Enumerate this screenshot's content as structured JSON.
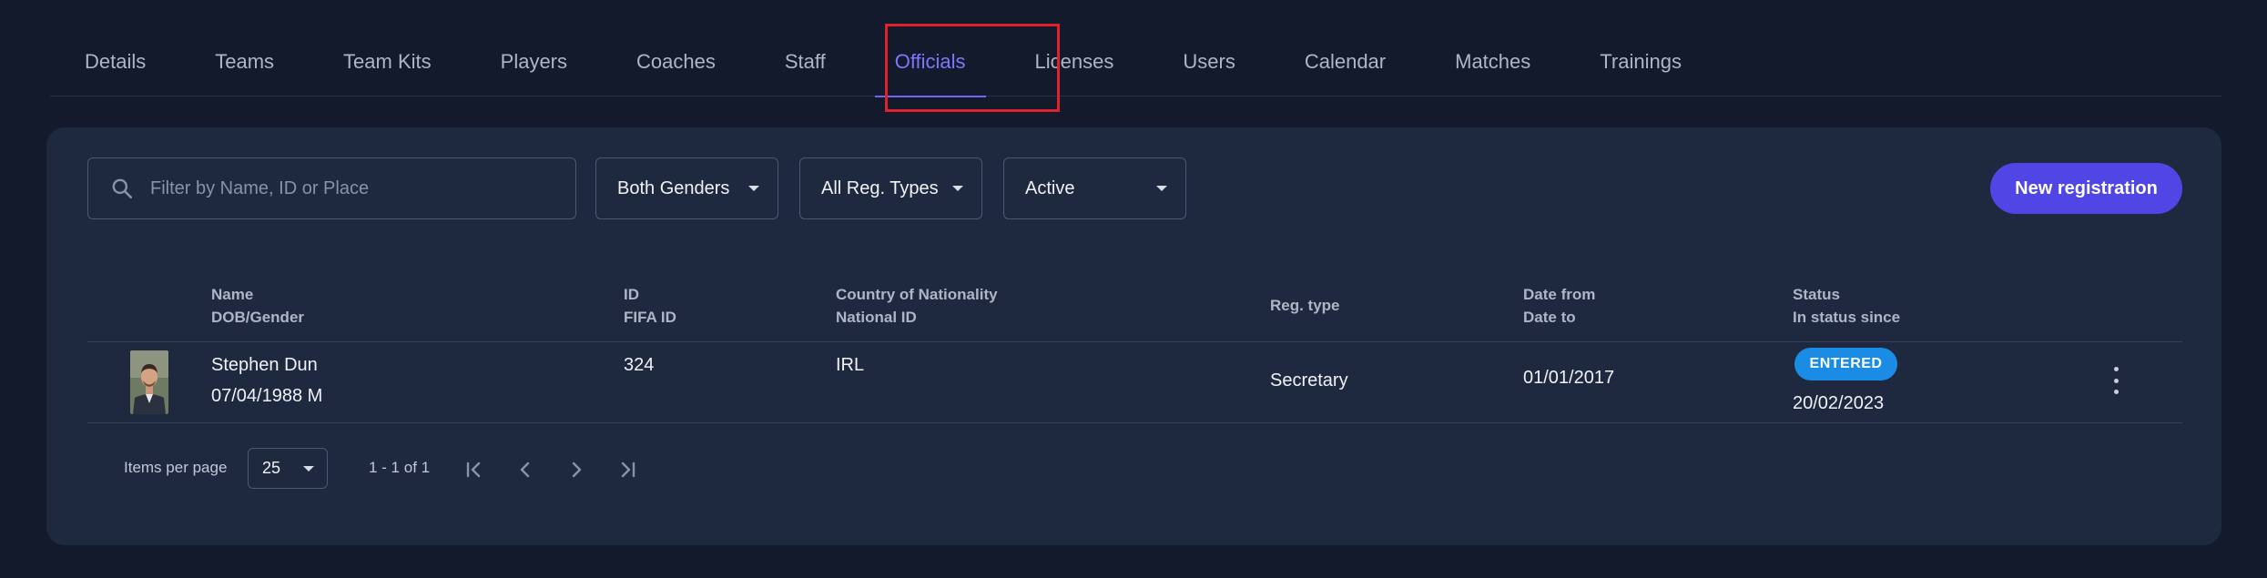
{
  "tabs": [
    "Details",
    "Teams",
    "Team Kits",
    "Players",
    "Coaches",
    "Staff",
    "Officials",
    "Licenses",
    "Users",
    "Calendar",
    "Matches",
    "Trainings"
  ],
  "active_tab": "Officials",
  "filters": {
    "search_placeholder": "Filter by Name, ID or Place",
    "gender": "Both Genders",
    "reg_type": "All Reg. Types",
    "status": "Active"
  },
  "new_registration_label": "New registration",
  "columns": {
    "name": "Name",
    "dob_gender": "DOB/Gender",
    "id": "ID",
    "fifa_id": "FIFA ID",
    "country": "Country of Nationality",
    "national_id": "National ID",
    "reg_type": "Reg. type",
    "date_from": "Date from",
    "date_to": "Date to",
    "status": "Status",
    "in_status_since": "In status since"
  },
  "rows": [
    {
      "name": "Stephen Dun",
      "dob_gender": "07/04/1988 M",
      "id": "324",
      "country": "IRL",
      "reg_type": "Secretary",
      "date_from": "01/01/2017",
      "status": "ENTERED",
      "status_since": "20/02/2023"
    }
  ],
  "pagination": {
    "items_per_page_label": "Items per page",
    "items_per_page": "25",
    "range": "1 - 1 of 1"
  },
  "colors": {
    "accent": "#5046e5",
    "status_entered": "#1a8ce6",
    "active_tab": "#7d76ff",
    "highlight": "#e0202a"
  }
}
